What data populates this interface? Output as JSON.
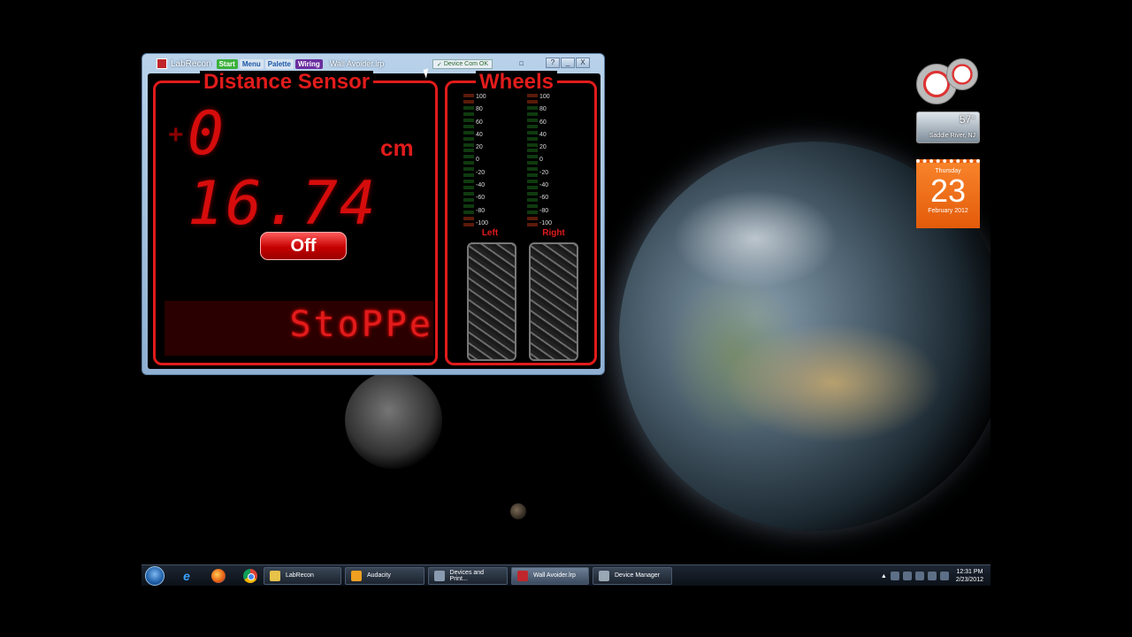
{
  "window": {
    "app_name": "LabRecon",
    "toolbar": {
      "start": "Start",
      "menu": "Menu",
      "palette": "Palette",
      "wiring": "Wiring"
    },
    "filename": "Wall Avoider.lrp",
    "device_status": "Device Com OK",
    "controls": [
      "?",
      "_",
      "X"
    ]
  },
  "distance_panel": {
    "title": "Distance Sensor",
    "sign": "+",
    "value": "0 16.74",
    "unit": "cm",
    "button_label": "Off",
    "ticker": "StoPPe"
  },
  "wheels_panel": {
    "title": "Wheels",
    "scale": [
      "100",
      "80",
      "60",
      "40",
      "20",
      "0",
      "-20",
      "-40",
      "-60",
      "-80",
      "-100"
    ],
    "left_label": "Left",
    "right_label": "Right"
  },
  "gadgets": {
    "weather_temp": "57°",
    "weather_location": "Saddle River, NJ",
    "calendar_day": "Thursday",
    "calendar_date": "23",
    "calendar_month": "February 2012"
  },
  "taskbar": {
    "tasks": [
      "LabRecon",
      "Audacity",
      "Devices and Print...",
      "Wall Avoider.lrp",
      "Device Manager"
    ],
    "time": "12:31 PM",
    "date": "2/23/2012"
  },
  "colors": {
    "accent": "#e11b1b",
    "background": "#000000"
  }
}
